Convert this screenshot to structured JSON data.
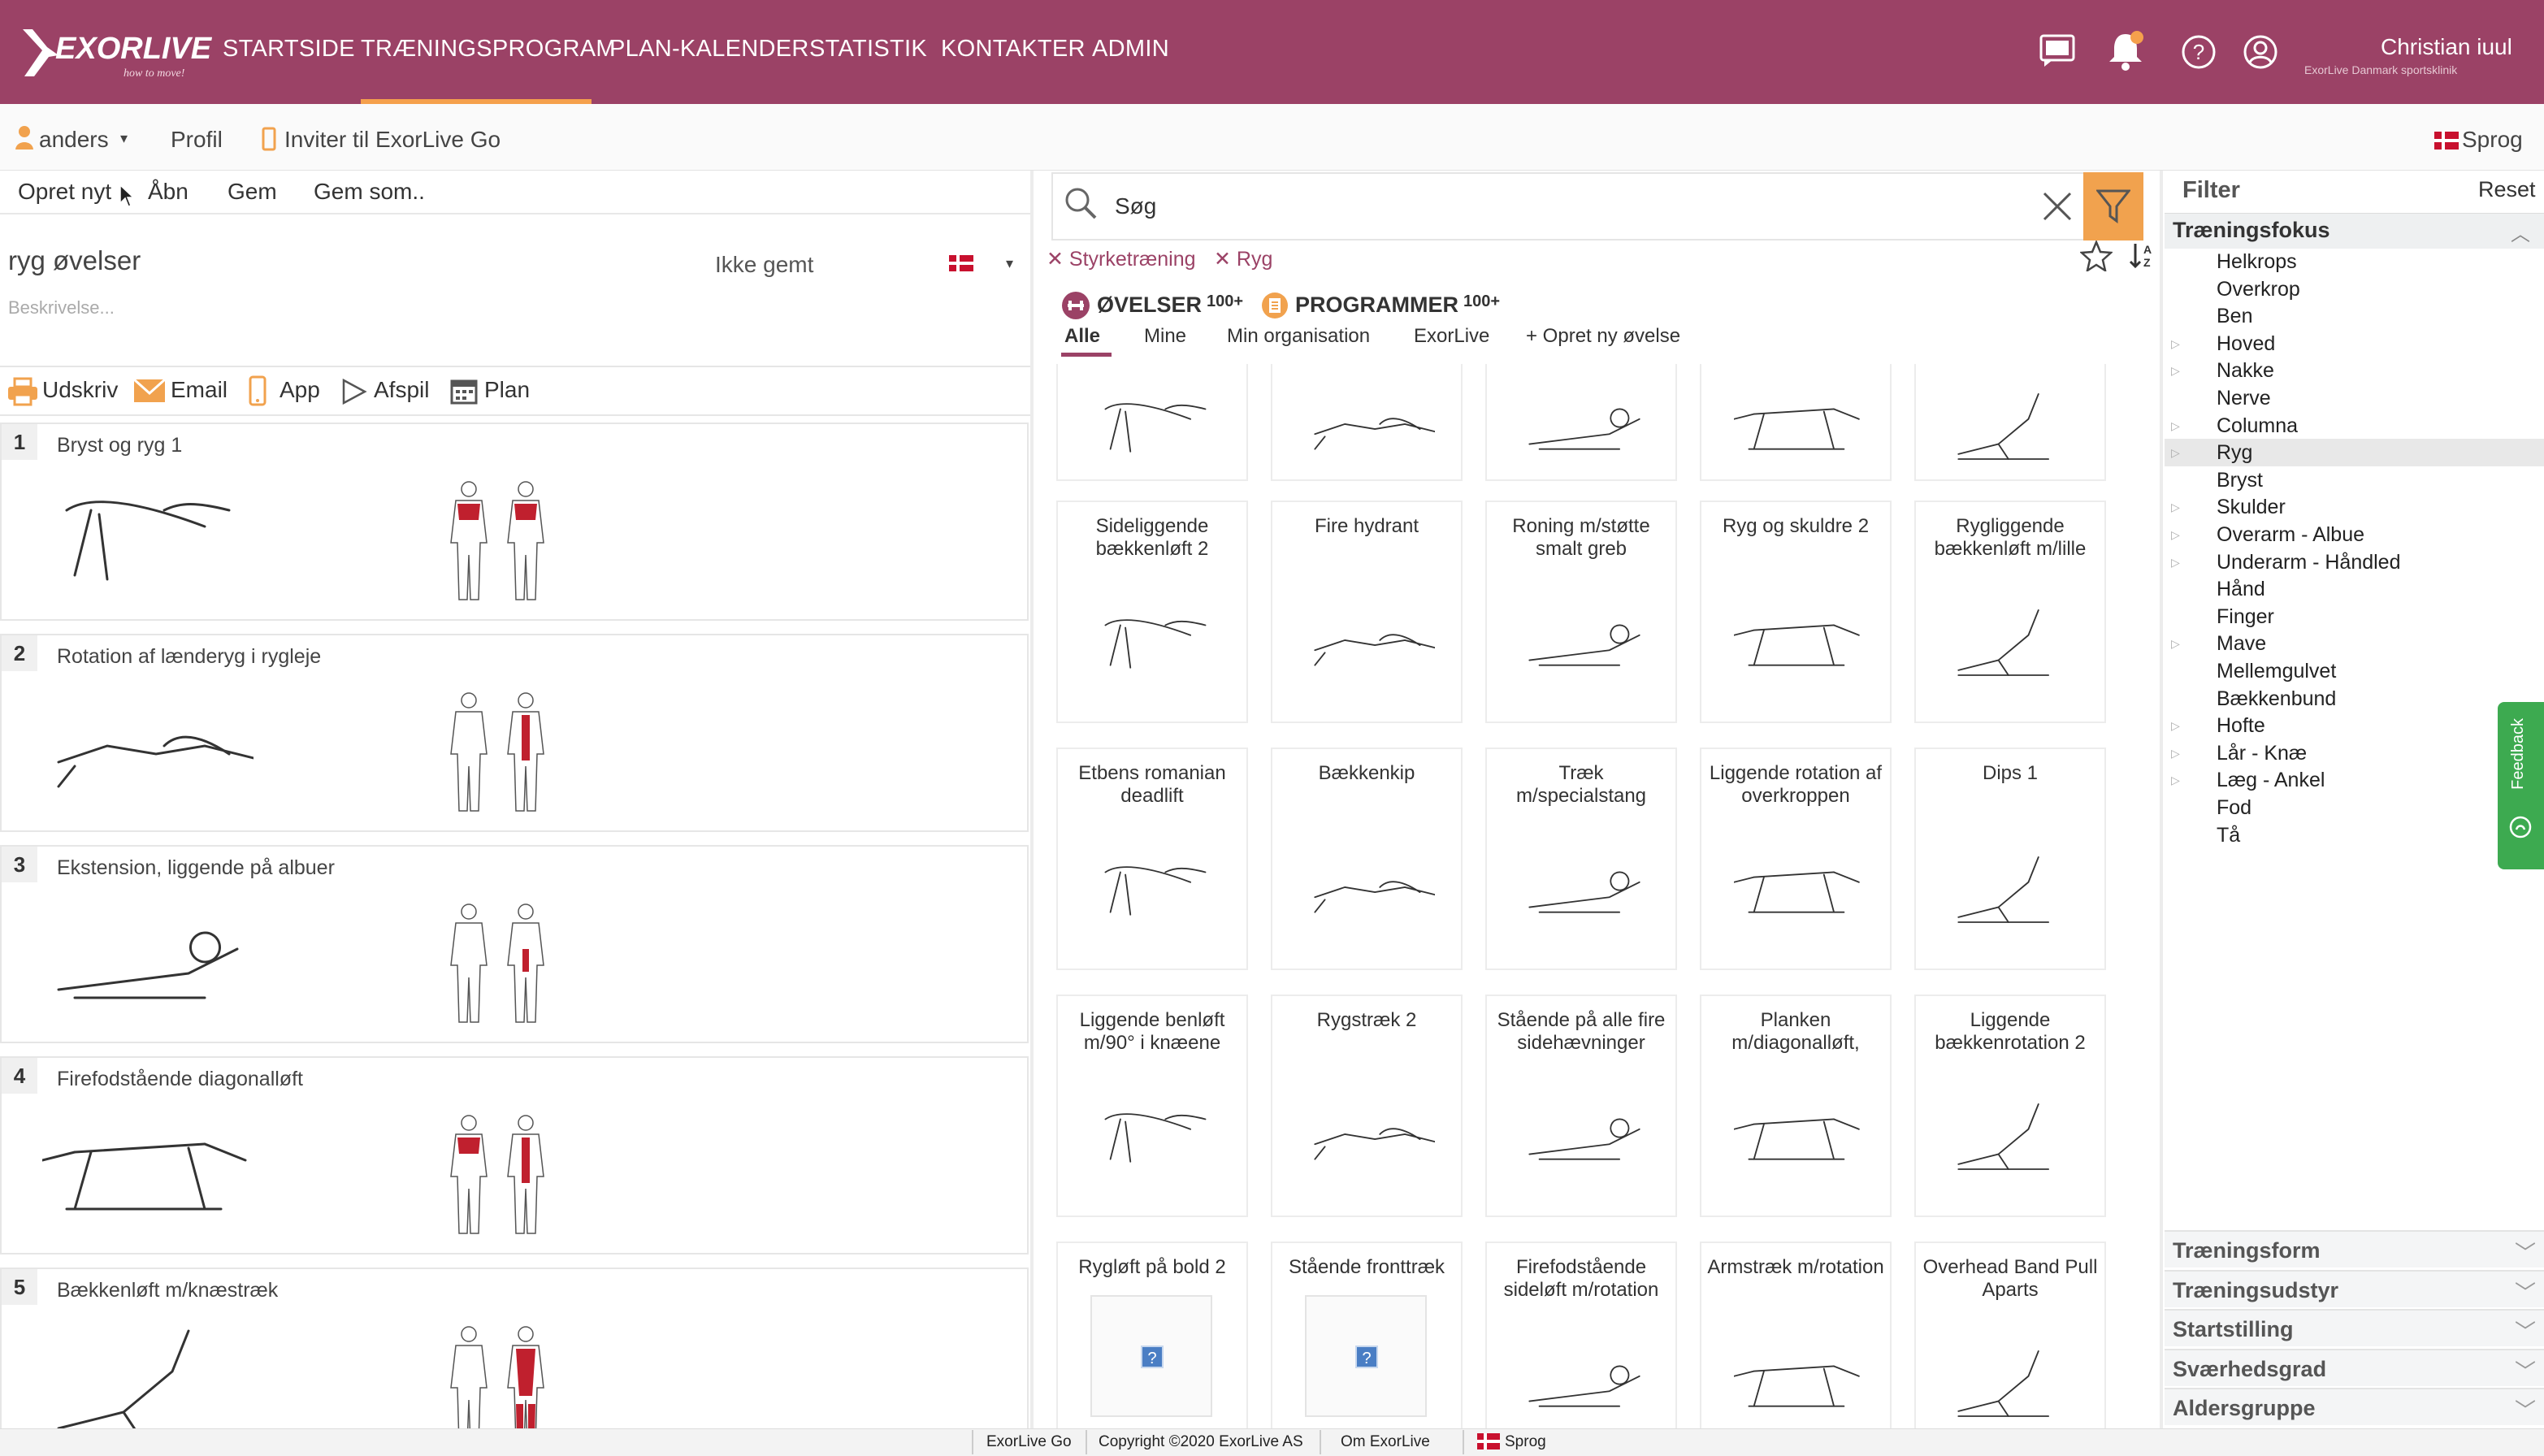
{
  "header": {
    "logo_text": "EXORLIVE",
    "logo_tagline": "how to move!",
    "nav": [
      "STARTSIDE",
      "TRÆNINGSPROGRAM",
      "PLAN-KALENDER",
      "STATISTIK",
      "KONTAKTER",
      "ADMIN"
    ],
    "active_nav": "TRÆNINGSPROGRAM",
    "user_name": "Christian iuul",
    "user_org": "ExorLive Danmark sportsklinik"
  },
  "subbar": {
    "user": "anders",
    "profile": "Profil",
    "invite": "Inviter til ExorLive Go",
    "language": "Sprog"
  },
  "toolbar": {
    "new": "Opret nyt",
    "open": "Åbn",
    "save": "Gem",
    "save_as": "Gem som.."
  },
  "program": {
    "title": "ryg øvelser",
    "status": "Ikke gemt",
    "description_placeholder": "Beskrivelse..."
  },
  "actions": {
    "print": "Udskriv",
    "email": "Email",
    "app": "App",
    "play": "Afspil",
    "plan": "Plan"
  },
  "program_exercises": [
    {
      "num": "1",
      "name": "Bryst og ryg 1"
    },
    {
      "num": "2",
      "name": "Rotation af lænderyg i rygleje"
    },
    {
      "num": "3",
      "name": "Ekstension, liggende på albuer"
    },
    {
      "num": "4",
      "name": "Firefodstående diagonalløft"
    },
    {
      "num": "5",
      "name": "Bækkenløft m/knæstræk"
    }
  ],
  "search": {
    "placeholder": "Søg",
    "chips": [
      "Styrketræning",
      "Ryg"
    ]
  },
  "content_tabs": {
    "exercises": "ØVELSER",
    "exercises_count": "100+",
    "programs": "PROGRAMMER",
    "programs_count": "100+"
  },
  "filter_tabs": [
    "Alle",
    "Mine",
    "Min organisation",
    "ExorLive",
    "+ Opret ny øvelse"
  ],
  "exercise_grid": [
    [
      "",
      "",
      "",
      "",
      ""
    ],
    [
      "Sideliggende bækkenløft 2",
      "Fire hydrant",
      "Roning m/støtte smalt greb",
      "Ryg og skuldre 2",
      "Rygliggende bækkenløft m/lille"
    ],
    [
      "Etbens romanian deadlift",
      "Bækkenkip",
      "Træk m/specialstang",
      "Liggende rotation af overkroppen",
      "Dips 1"
    ],
    [
      "Liggende benløft m/90° i knæene",
      "Rygstræk 2",
      "Stående på alle fire sidehævninger",
      "Planken m/diagonalløft,",
      "Liggende bækkenrotation 2"
    ],
    [
      "Rygløft på bold 2",
      "Stående fronttræk",
      "Firefodstående sideløft m/rotation",
      "Armstræk m/rotation",
      "Overhead Band Pull Aparts"
    ]
  ],
  "filter_panel": {
    "title": "Filter",
    "reset": "Reset",
    "focus_title": "Træningsfokus",
    "focus_items": [
      "Helkrops",
      "Overkrop",
      "Ben",
      "Hoved",
      "Nakke",
      "Nerve",
      "Columna",
      "Ryg",
      "Bryst",
      "Skulder",
      "Overarm - Albue",
      "Underarm - Håndled",
      "Hånd",
      "Finger",
      "Mave",
      "Mellemgulvet",
      "Bækkenbund",
      "Hofte",
      "Lår - Knæ",
      "Læg - Ankel",
      "Fod",
      "Tå"
    ],
    "selected": "Ryg",
    "sections": [
      "Træningsform",
      "Træningsudstyr",
      "Startstilling",
      "Sværhedsgrad",
      "Aldersgruppe"
    ]
  },
  "feedback": "Feedback",
  "footer": {
    "go": "ExorLive Go",
    "copyright": "Copyright ©2020 ExorLive AS",
    "about": "Om ExorLive",
    "language": "Sprog"
  },
  "colors": {
    "brand": "#9b4266",
    "accent": "#f1a24e",
    "muscle": "#c0202e",
    "feedback": "#3daa50"
  }
}
